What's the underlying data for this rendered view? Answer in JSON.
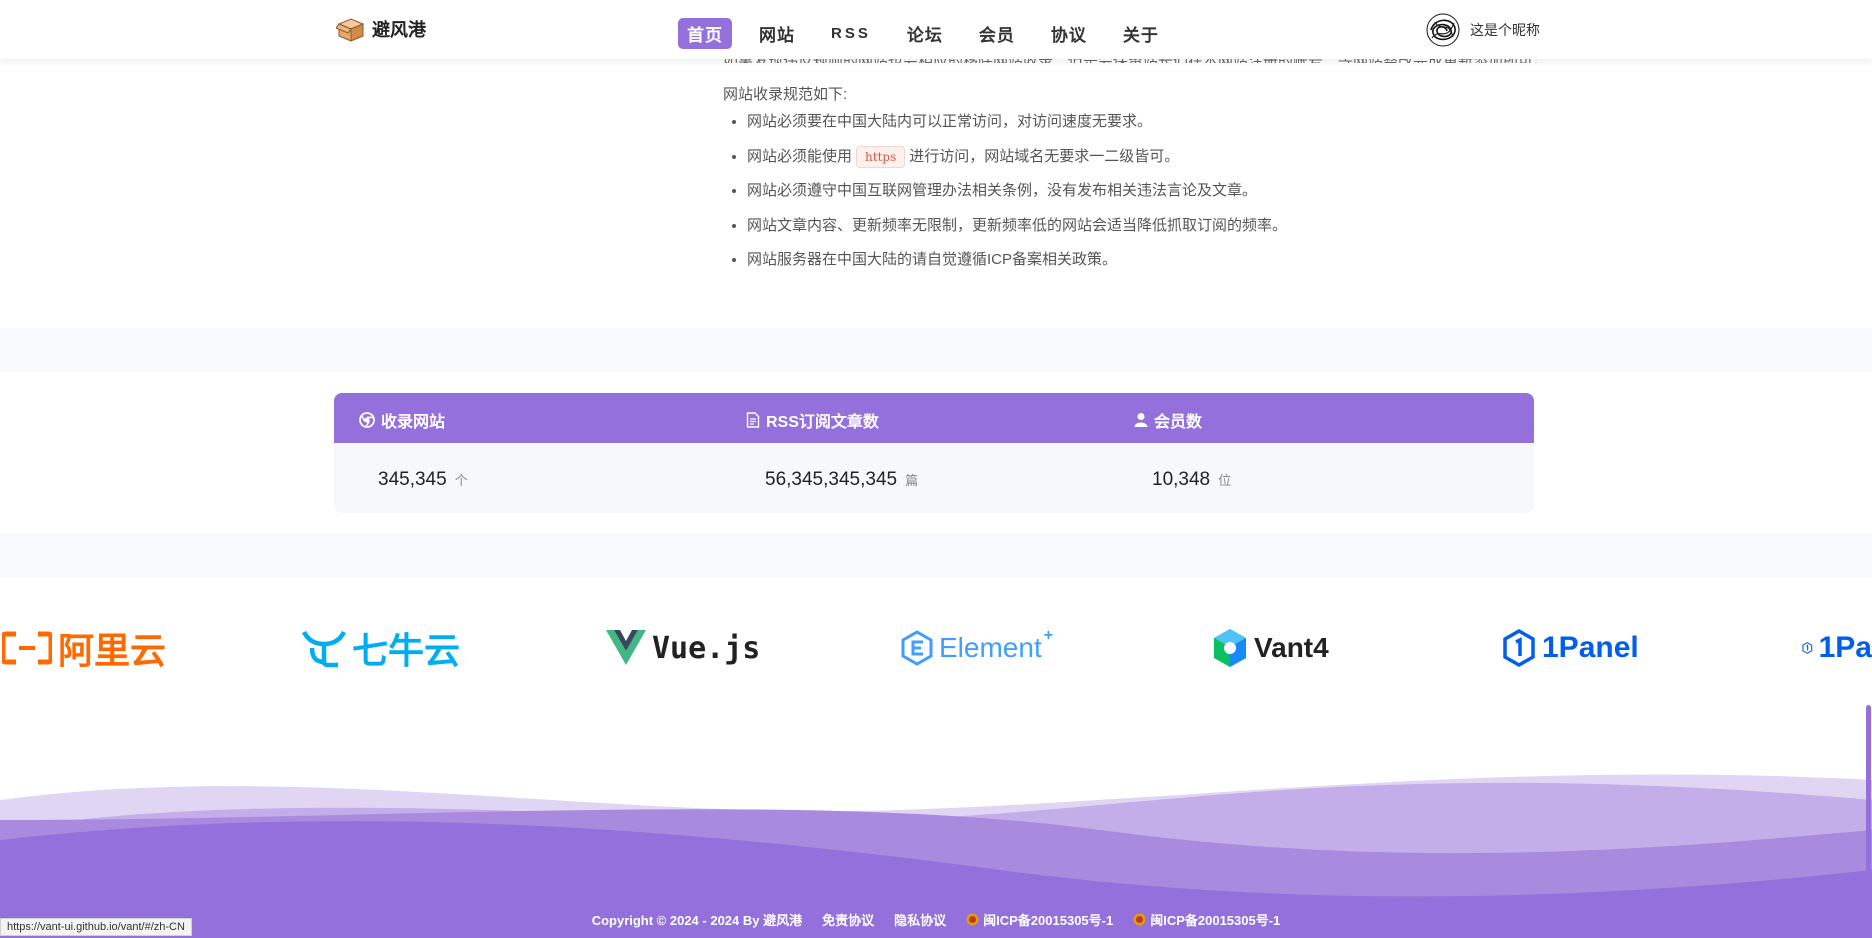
{
  "header": {
    "brand_name": "避风港",
    "nav": [
      {
        "label": "首页",
        "active": true
      },
      {
        "label": "网站",
        "active": false
      },
      {
        "label": "RSS",
        "active": false
      },
      {
        "label": "论坛",
        "active": false
      },
      {
        "label": "会员",
        "active": false
      },
      {
        "label": "协议",
        "active": false
      },
      {
        "label": "关于",
        "active": false
      }
    ],
    "user_name": "这是个昵称"
  },
  "rules": {
    "cut_line": "如果发现违反规则的网站也会相应的移除网站收录，但是会保留站长们在本网站注册的账号，等网站整改完成重新添加即可。",
    "title": "网站收录规范如下:",
    "items": [
      {
        "text": "网站必须要在中国大陆内可以正常访问，对访问速度无要求。"
      },
      {
        "before": "网站必须能使用",
        "code": "https",
        "after": "进行访问，网站域名无要求一二级皆可。"
      },
      {
        "text": "网站必须遵守中国互联网管理办法相关条例，没有发布相关违法言论及文章。"
      },
      {
        "text": "网站文章内容、更新频率无限制，更新频率低的网站会适当降低抓取订阅的频率。"
      },
      {
        "text": "网站服务器在中国大陆的请自觉遵循ICP备案相关政策。"
      }
    ]
  },
  "stats": {
    "columns": [
      {
        "label": "收录网站",
        "icon": "chrome-icon",
        "value": "345,345",
        "unit": "个"
      },
      {
        "label": "RSS订阅文章数",
        "icon": "document-icon",
        "value": "56,345,345,345",
        "unit": "篇"
      },
      {
        "label": "会员数",
        "icon": "user-icon",
        "value": "10,348",
        "unit": "位"
      }
    ]
  },
  "sponsors": [
    {
      "name": "阿里云",
      "color": "#ff6a00"
    },
    {
      "name": "七牛云",
      "color": "#00aeef"
    },
    {
      "name": "Vue.js",
      "color": "#222222"
    },
    {
      "name": "Element",
      "color": "#409eff"
    },
    {
      "name": "Vant4",
      "color": "#222222"
    },
    {
      "name": "1Panel",
      "color": "#005eeb"
    },
    {
      "name": "1Pa",
      "color": "#005eeb"
    }
  ],
  "footer": {
    "copyright": "Copyright © 2024 - 2024 By 避风港",
    "disclaimer": "免责协议",
    "privacy": "隐私协议",
    "icp1": "闽ICP备20015305号-1",
    "icp2": "闽ICP备20015305号-1"
  },
  "status_url": "https://vant-ui.github.io/vant/#/zh-CN",
  "colors": {
    "accent": "#9370db",
    "band": "#f8f9fc"
  }
}
